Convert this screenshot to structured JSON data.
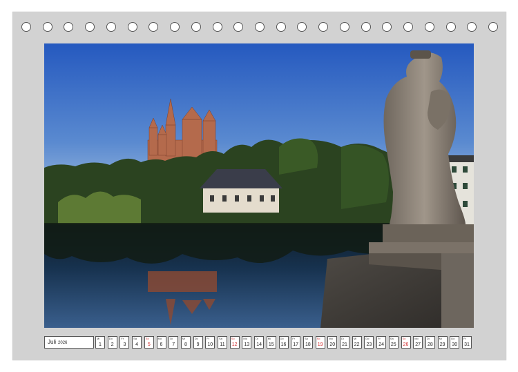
{
  "calendar": {
    "month": "Juli",
    "year": "2026",
    "hole_count": 23,
    "days": [
      {
        "wd": "Mi",
        "d": "1",
        "red": false
      },
      {
        "wd": "Do",
        "d": "2",
        "red": false
      },
      {
        "wd": "Fr",
        "d": "3",
        "red": false
      },
      {
        "wd": "Sa",
        "d": "4",
        "red": false
      },
      {
        "wd": "So",
        "d": "5",
        "red": true
      },
      {
        "wd": "Mo",
        "d": "6",
        "red": false
      },
      {
        "wd": "Di",
        "d": "7",
        "red": false
      },
      {
        "wd": "Mi",
        "d": "8",
        "red": false
      },
      {
        "wd": "Do",
        "d": "9",
        "red": false
      },
      {
        "wd": "Fr",
        "d": "10",
        "red": false
      },
      {
        "wd": "Sa",
        "d": "11",
        "red": false
      },
      {
        "wd": "So",
        "d": "12",
        "red": true
      },
      {
        "wd": "Mo",
        "d": "13",
        "red": false
      },
      {
        "wd": "Di",
        "d": "14",
        "red": false
      },
      {
        "wd": "Mi",
        "d": "15",
        "red": false
      },
      {
        "wd": "Do",
        "d": "16",
        "red": false
      },
      {
        "wd": "Fr",
        "d": "17",
        "red": false
      },
      {
        "wd": "Sa",
        "d": "18",
        "red": false
      },
      {
        "wd": "So",
        "d": "19",
        "red": true
      },
      {
        "wd": "Mo",
        "d": "20",
        "red": false
      },
      {
        "wd": "Di",
        "d": "21",
        "red": false
      },
      {
        "wd": "Mi",
        "d": "22",
        "red": false
      },
      {
        "wd": "Do",
        "d": "23",
        "red": false
      },
      {
        "wd": "Fr",
        "d": "24",
        "red": false
      },
      {
        "wd": "Sa",
        "d": "25",
        "red": false
      },
      {
        "wd": "So",
        "d": "26",
        "red": true
      },
      {
        "wd": "Mo",
        "d": "27",
        "red": false
      },
      {
        "wd": "Di",
        "d": "28",
        "red": false
      },
      {
        "wd": "Mi",
        "d": "29",
        "red": false
      },
      {
        "wd": "Do",
        "d": "30",
        "red": false
      },
      {
        "wd": "Fr",
        "d": "31",
        "red": false
      }
    ]
  },
  "colors": {
    "sky_top": "#2b63c4",
    "sky_bottom": "#a9c3e0",
    "cathedral": "#b86a4e",
    "trees": "#2f4a1f",
    "water": "#1f3556",
    "statue": "#8c8276",
    "sunday": "#d0292a"
  }
}
